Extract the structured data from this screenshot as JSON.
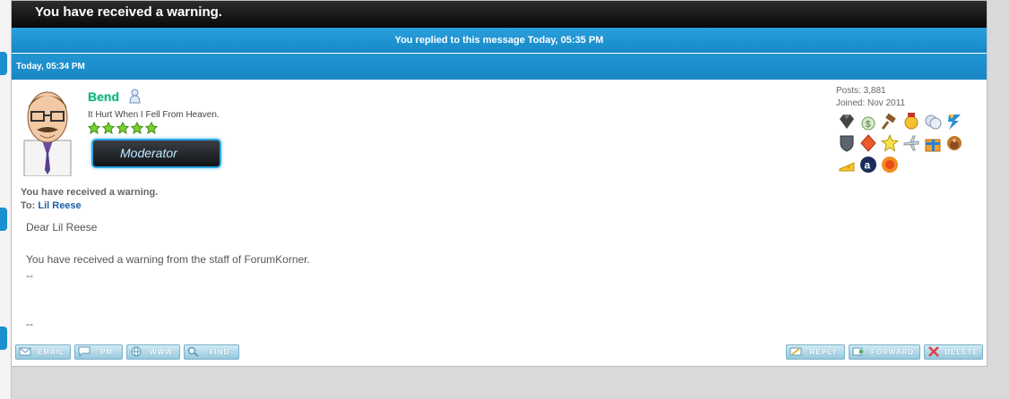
{
  "window": {
    "title": "You have received a warning."
  },
  "notice": {
    "replied": "You replied to this message Today, 05:35 PM"
  },
  "post": {
    "date": "Today, 05:34 PM",
    "author": {
      "name": "Bend",
      "user_title": "It Hurt When I Fell From Heaven.",
      "rank_stars": 5,
      "badge": "Moderator",
      "posts": "Posts: 3,881",
      "joined": "Joined: Nov 2011"
    },
    "awards": [
      "diamond-icon",
      "money-bag-icon",
      "gavel-icon",
      "gold-medal-icon",
      "badges-icon",
      "lightning-icon",
      "shield-icon",
      "ruby-icon",
      "star-icon",
      "airplane-icon",
      "gift-icon",
      "turkey-icon",
      "cheese-icon",
      "amazon-icon",
      "sun-icon"
    ],
    "title": "You have received a warning.",
    "to_label": "To:",
    "to_name": "Lil Reese",
    "body": {
      "greeting": "Dear Lil Reese",
      "line1": "You have received a warning from the staff of ForumKorner.",
      "sep1": "--",
      "sep2": "--"
    }
  },
  "buttons": {
    "email": "EMAIL",
    "pm": "PM",
    "www": "WWW",
    "find": "FIND",
    "reply": "REPLY",
    "forward": "FORWARD",
    "delete": "DELETE"
  }
}
